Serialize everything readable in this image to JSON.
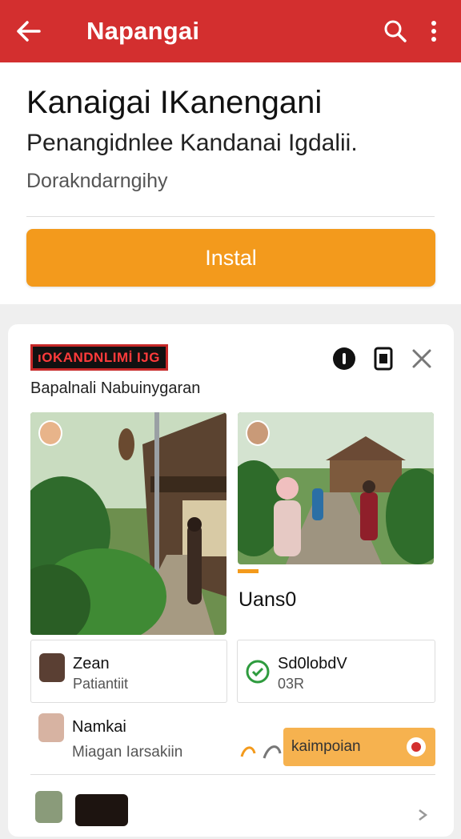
{
  "appbar": {
    "title": "Napangai",
    "bg": "#d32f2f",
    "icons": [
      "back-arrow-icon",
      "search-icon",
      "more-vert-icon"
    ]
  },
  "header": {
    "title": "Kanaigai IKanengani",
    "subtitle": "Penangidnlee Kandanai Igdalii.",
    "developer": "Dorakndarngihy",
    "install_label": "Instal",
    "accent": "#f39a1c"
  },
  "card": {
    "banner_text": "ıOKANDNLIMİ IJGI",
    "caption": "Bapalnali Nabuinygaran",
    "icons": [
      "info-icon",
      "phone-icon",
      "close-icon"
    ],
    "media_label": "Uans0",
    "users": [
      {
        "name": "Zean",
        "detail": "Patiantiit"
      },
      {
        "name": "Sd0lobdV",
        "detail": "03R"
      }
    ],
    "featured_user": {
      "name": "Namkai",
      "detail": "Miagan Iarsakiin",
      "button_label": "kaimpoian"
    }
  }
}
